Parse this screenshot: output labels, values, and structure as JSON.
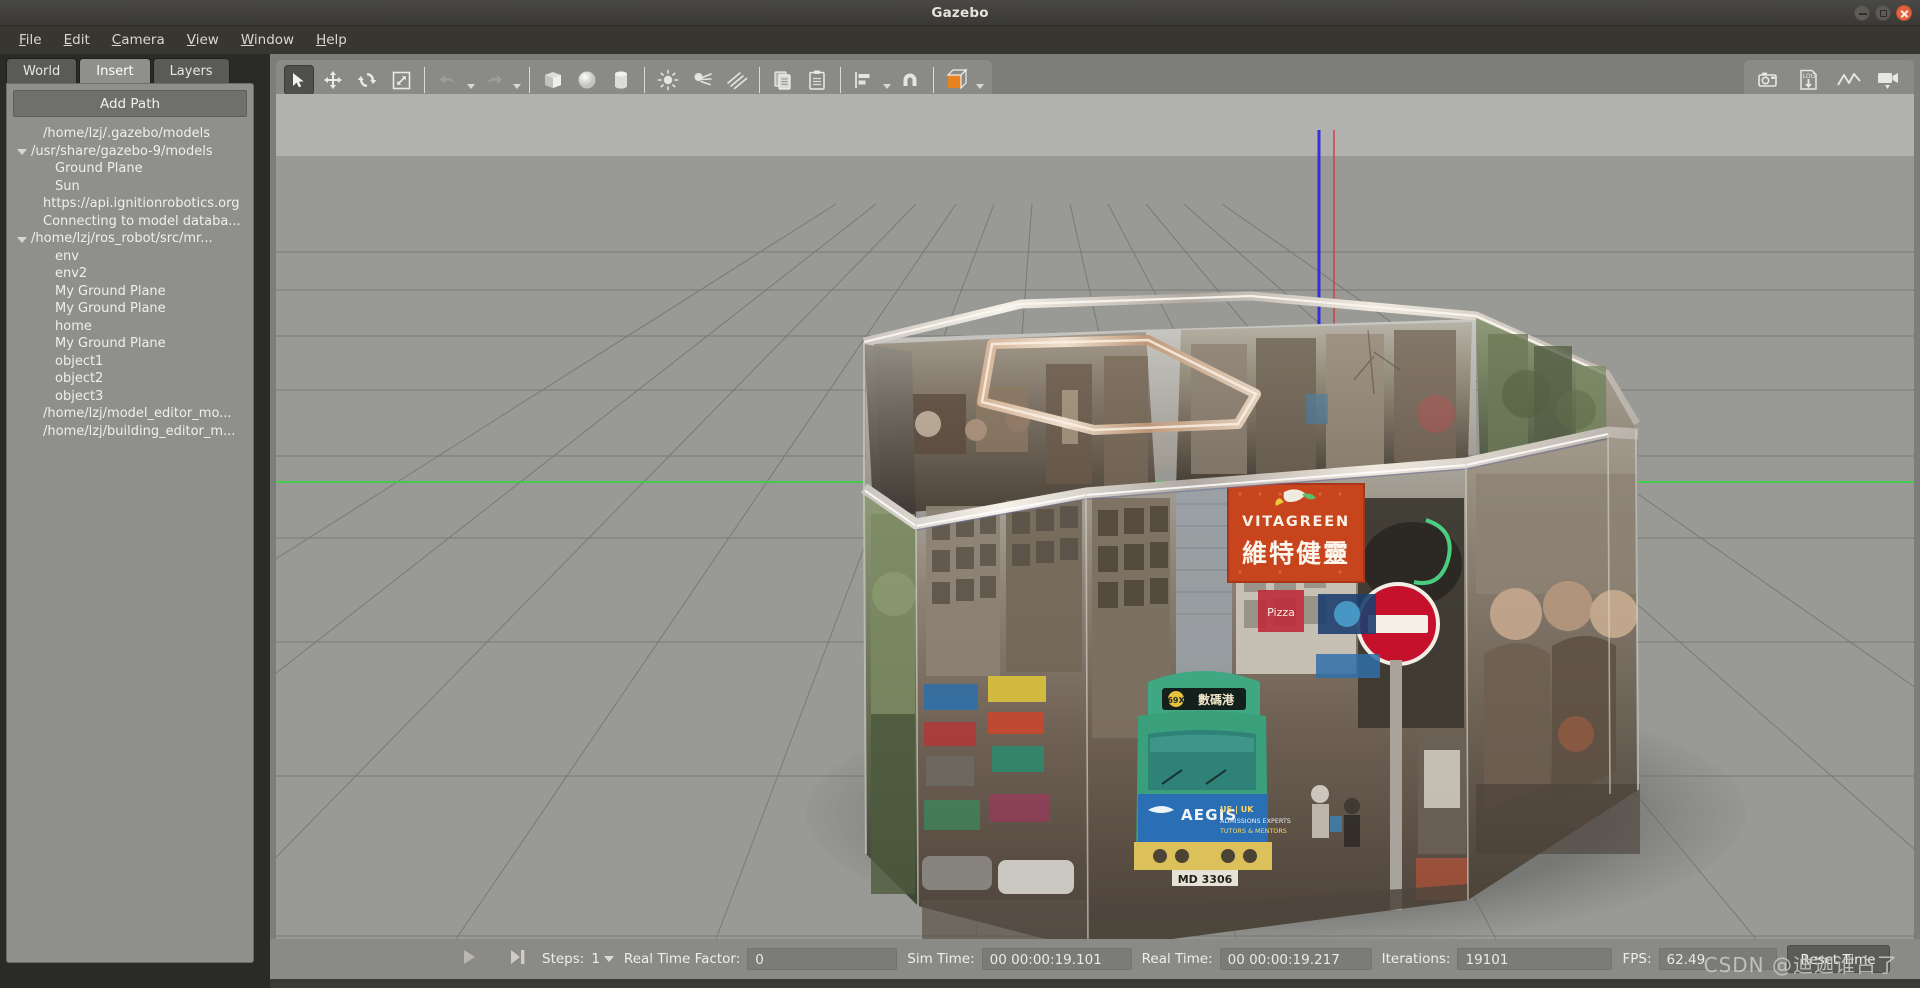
{
  "window": {
    "title": "Gazebo",
    "controls": [
      {
        "name": "minimize",
        "glyph": "dash"
      },
      {
        "name": "maximize",
        "glyph": "square"
      },
      {
        "name": "close",
        "glyph": "x"
      }
    ],
    "accent_close": "#e2623c"
  },
  "menubar": {
    "items": [
      {
        "label": "File",
        "mnemonic": "F"
      },
      {
        "label": "Edit",
        "mnemonic": "E"
      },
      {
        "label": "Camera",
        "mnemonic": "C"
      },
      {
        "label": "View",
        "mnemonic": "V"
      },
      {
        "label": "Window",
        "mnemonic": "W"
      },
      {
        "label": "Help",
        "mnemonic": "H"
      }
    ]
  },
  "left_panel": {
    "tabs": [
      {
        "label": "World",
        "active": false
      },
      {
        "label": "Insert",
        "active": true
      },
      {
        "label": "Layers",
        "active": false
      }
    ],
    "add_path_label": "Add Path",
    "tree": [
      {
        "label": "/home/lzj/.gazebo/models",
        "indent": 1,
        "expandable": false
      },
      {
        "label": "/usr/share/gazebo-9/models",
        "indent": 0,
        "expandable": true,
        "expanded": true
      },
      {
        "label": "Ground Plane",
        "indent": 2,
        "expandable": false
      },
      {
        "label": "Sun",
        "indent": 2,
        "expandable": false
      },
      {
        "label": "https://api.ignitionrobotics.org",
        "indent": 1,
        "expandable": false
      },
      {
        "label": "Connecting to model databa...",
        "indent": 1,
        "expandable": false
      },
      {
        "label": "/home/lzj/ros_robot/src/mr...",
        "indent": 0,
        "expandable": true,
        "expanded": true
      },
      {
        "label": "env",
        "indent": 2,
        "expandable": false
      },
      {
        "label": "env2",
        "indent": 2,
        "expandable": false
      },
      {
        "label": "My Ground Plane",
        "indent": 2,
        "expandable": false
      },
      {
        "label": "My Ground Plane",
        "indent": 2,
        "expandable": false
      },
      {
        "label": "home",
        "indent": 2,
        "expandable": false
      },
      {
        "label": "My Ground Plane",
        "indent": 2,
        "expandable": false
      },
      {
        "label": "object1",
        "indent": 2,
        "expandable": false
      },
      {
        "label": "object2",
        "indent": 2,
        "expandable": false
      },
      {
        "label": "object3",
        "indent": 2,
        "expandable": false
      },
      {
        "label": "/home/lzj/model_editor_mo...",
        "indent": 1,
        "expandable": false
      },
      {
        "label": "/home/lzj/building_editor_m...",
        "indent": 1,
        "expandable": false
      }
    ]
  },
  "toolbar": {
    "left_tools": [
      {
        "icon": "select-arrow-icon",
        "pressed": true
      },
      {
        "icon": "translate-icon",
        "pressed": false
      },
      {
        "icon": "rotate-icon",
        "pressed": false
      },
      {
        "icon": "scale-icon",
        "pressed": false
      },
      {
        "icon": "undo-icon",
        "pressed": false
      },
      {
        "icon": "redo-icon",
        "pressed": false
      },
      {
        "icon": "box-icon",
        "pressed": false
      },
      {
        "icon": "sphere-icon",
        "pressed": false
      },
      {
        "icon": "cylinder-icon",
        "pressed": false
      },
      {
        "icon": "point-light-icon",
        "pressed": false
      },
      {
        "icon": "spot-light-icon",
        "pressed": false
      },
      {
        "icon": "directional-light-icon",
        "pressed": false
      },
      {
        "icon": "copy-icon",
        "pressed": false
      },
      {
        "icon": "paste-icon",
        "pressed": false
      },
      {
        "icon": "align-icon",
        "pressed": false
      },
      {
        "icon": "snap-magnet-icon",
        "pressed": false
      },
      {
        "icon": "view-angle-cube-icon",
        "pressed": false
      }
    ],
    "right_tools": [
      {
        "icon": "screenshot-camera-icon"
      },
      {
        "icon": "log-download-icon",
        "label": "LOG"
      },
      {
        "icon": "plot-line-icon"
      },
      {
        "icon": "video-record-icon"
      }
    ],
    "cube_accent": "#e8821e"
  },
  "viewport": {
    "sky_color": "#b1b1af",
    "ground_color": "#999996",
    "grid_color": "#6e6e6c",
    "axis_x_color": "#d03a3a",
    "axis_y_color": "#3ad04a",
    "axis_z_color": "#2a2ad8",
    "scene_description": "Octagonal panoramic billboard structure with Hong Kong street-scene textures",
    "scene_texts": [
      "VITAGREEN",
      "維特健靈",
      "AEGIS",
      "US | UK",
      "ADMISSIONS EXPERTS",
      "TUTORS & MENTORS",
      "MD 3306",
      "69X",
      "數碼港"
    ]
  },
  "statusbar": {
    "play_icon": "play-icon",
    "step_icon": "step-forward-icon",
    "steps_label": "Steps:",
    "steps_value": "1",
    "rtf_label": "Real Time Factor:",
    "rtf_value": "0",
    "sim_time_label": "Sim Time:",
    "sim_time_value": "00 00:00:19.101",
    "real_time_label": "Real Time:",
    "real_time_value": "00 00:00:19.217",
    "iterations_label": "Iterations:",
    "iterations_value": "19101",
    "fps_label": "FPS:",
    "fps_value": "62.49",
    "reset_time_label": "Reset Time"
  },
  "watermark": {
    "text": "CSDN @迪迦谁占了"
  }
}
